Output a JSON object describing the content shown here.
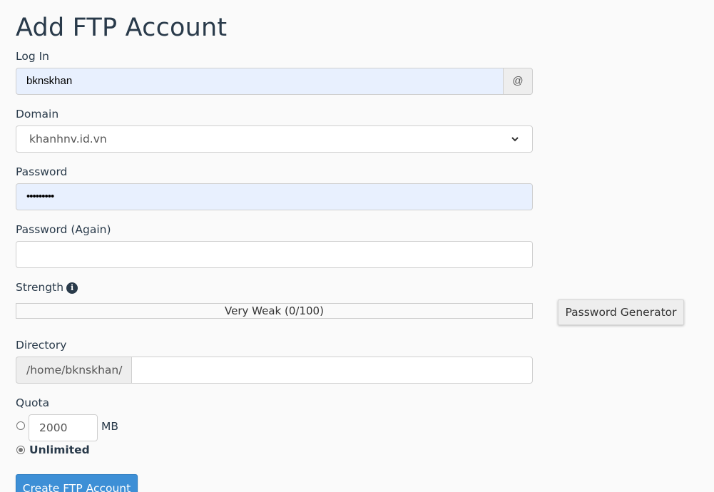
{
  "page": {
    "title": "Add FTP Account"
  },
  "form": {
    "login": {
      "label": "Log In",
      "value": "bknskhan",
      "addon": "@"
    },
    "domain": {
      "label": "Domain",
      "selected": "khanhnv.id.vn"
    },
    "password": {
      "label": "Password",
      "masked_value": "•••••••••"
    },
    "password_again": {
      "label": "Password (Again)",
      "value": ""
    },
    "strength": {
      "label": "Strength",
      "info_icon": "info-circle-icon",
      "text": "Very Weak (0/100)",
      "score": 0,
      "max": 100
    },
    "password_generator": {
      "label": "Password Generator"
    },
    "directory": {
      "label": "Directory",
      "prefix": "/home/bknskhan/",
      "value": ""
    },
    "quota": {
      "label": "Quota",
      "limited_value": "2000",
      "unit": "MB",
      "unlimited_label": "Unlimited",
      "selected": "unlimited"
    },
    "submit": {
      "label": "Create FTP Account"
    }
  },
  "colors": {
    "primary_button": "#3d8fd6",
    "autofill_background": "#e8f0fe",
    "text": "#293a4a"
  }
}
